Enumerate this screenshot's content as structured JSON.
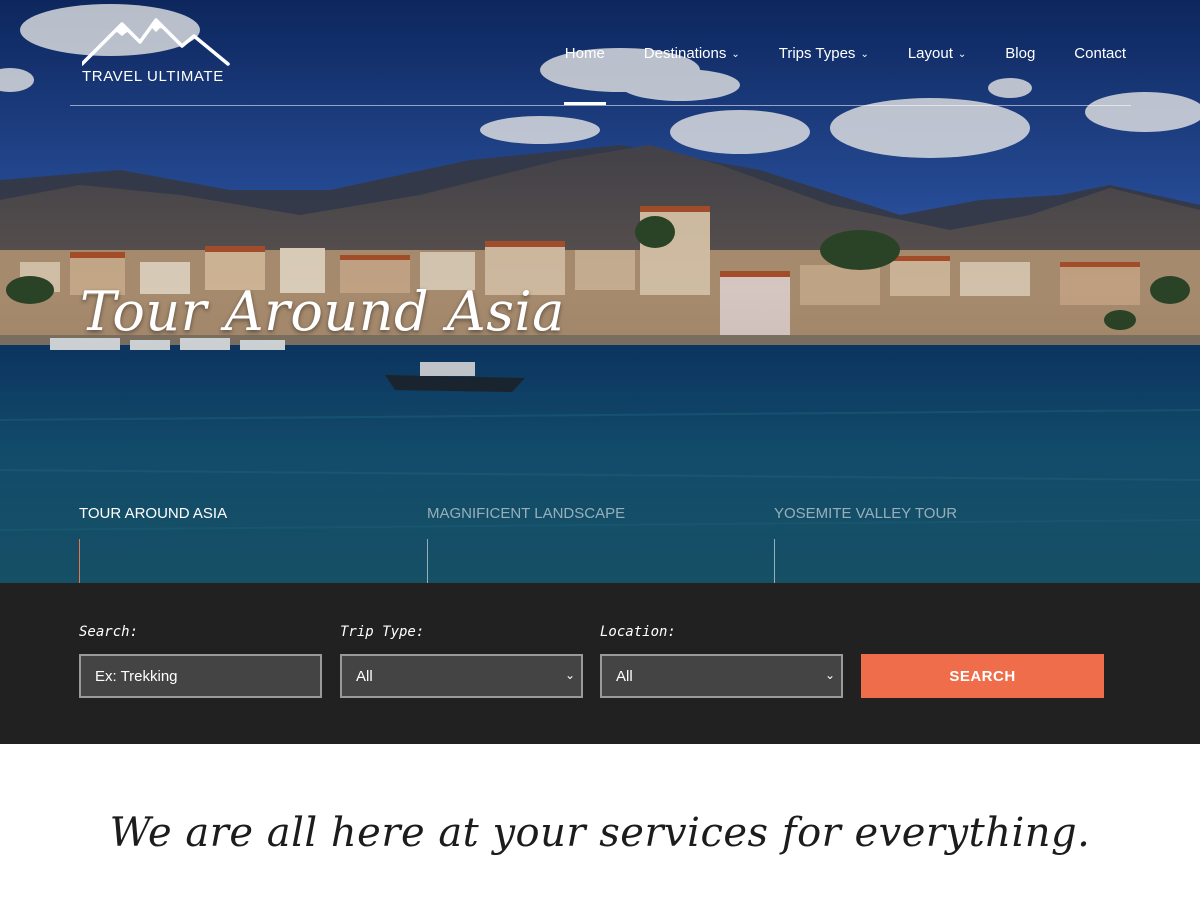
{
  "colors": {
    "accent": "#ef6d4a",
    "search_bar_bg": "#212121",
    "field_bg": "#444444",
    "active_slide_line": "#e8744f"
  },
  "logo": {
    "text": "TRAVEL ULTIMATE",
    "icon": "mountain-icon"
  },
  "nav": {
    "items": [
      {
        "label": "Home",
        "active": true
      },
      {
        "label": "Destinations",
        "dropdown": true
      },
      {
        "label": "Trips Types",
        "dropdown": true
      },
      {
        "label": "Layout",
        "dropdown": true
      },
      {
        "label": "Blog"
      },
      {
        "label": "Contact"
      }
    ]
  },
  "hero": {
    "title": "Tour Around Asia"
  },
  "slides": [
    {
      "label": "TOUR AROUND ASIA",
      "active": true
    },
    {
      "label": "MAGNIFICENT LANDSCAPE"
    },
    {
      "label": "YOSEMITE VALLEY TOUR"
    }
  ],
  "search_form": {
    "search_label": "Search:",
    "search_placeholder": "Ex: Trekking",
    "trip_type_label": "Trip Type:",
    "trip_type_value": "All",
    "location_label": "Location:",
    "location_value": "All",
    "button_label": "SEARCH"
  },
  "tagline": "We are all here at your services for everything."
}
